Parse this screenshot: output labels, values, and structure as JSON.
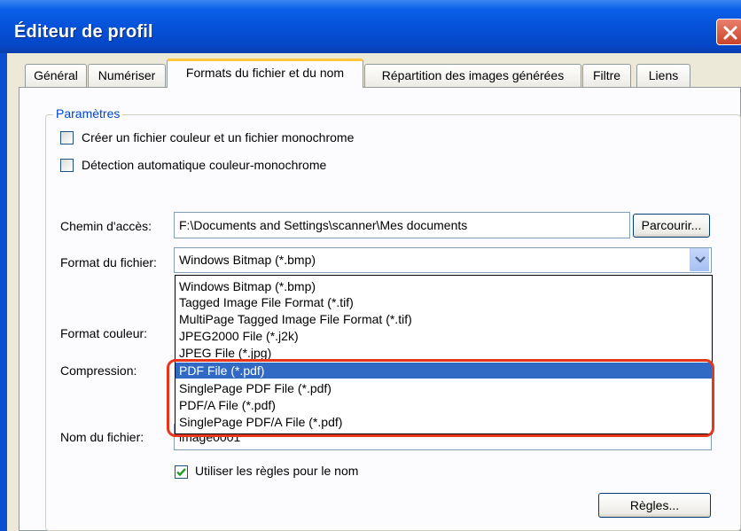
{
  "window": {
    "title": "Éditeur de profil",
    "close_icon": "close-icon"
  },
  "tabs": [
    {
      "label": "Général"
    },
    {
      "label": "Numériser"
    },
    {
      "label": "Formats du fichier et du nom",
      "active": true
    },
    {
      "label": "Répartition des images générées"
    },
    {
      "label": "Filtre"
    },
    {
      "label": "Liens"
    }
  ],
  "group": {
    "legend": "Paramètres"
  },
  "checkboxes": {
    "color_mono": {
      "label": "Créer un fichier couleur et un fichier monochrome",
      "checked": false
    },
    "auto_detect": {
      "label": "Détection automatique couleur-monochrome",
      "checked": false
    },
    "use_rules": {
      "label": "Utiliser les règles pour le nom",
      "checked": true
    }
  },
  "fields": {
    "path": {
      "label": "Chemin d'accès:",
      "value": "F:\\Documents and Settings\\scanner\\Mes documents",
      "browse_label": "Parcourir..."
    },
    "format": {
      "label": "Format du fichier:",
      "value": "Windows Bitmap (*.bmp)"
    },
    "color_format": {
      "label": "Format couleur:"
    },
    "compression": {
      "label": "Compression:"
    },
    "filename": {
      "label": "Nom du fichier:",
      "value": "image0001"
    }
  },
  "dropdown_options": [
    "Windows Bitmap (*.bmp)",
    "Tagged Image File Format (*.tif)",
    "MultiPage Tagged Image File Format (*.tif)",
    "JPEG2000 File (*.j2k)",
    "JPEG File (*.jpg)",
    "PDF File (*.pdf)",
    "SinglePage PDF File (*.pdf)",
    "PDF/A File (*.pdf)",
    "SinglePage PDF/A File (*.pdf)"
  ],
  "selected_option_index": 5,
  "buttons": {
    "rules_label": "Règles..."
  },
  "colors": {
    "titlebar": "#0652d8",
    "selection": "#316ac5",
    "highlight": "#e8361c",
    "group_legend": "#0046d5"
  }
}
